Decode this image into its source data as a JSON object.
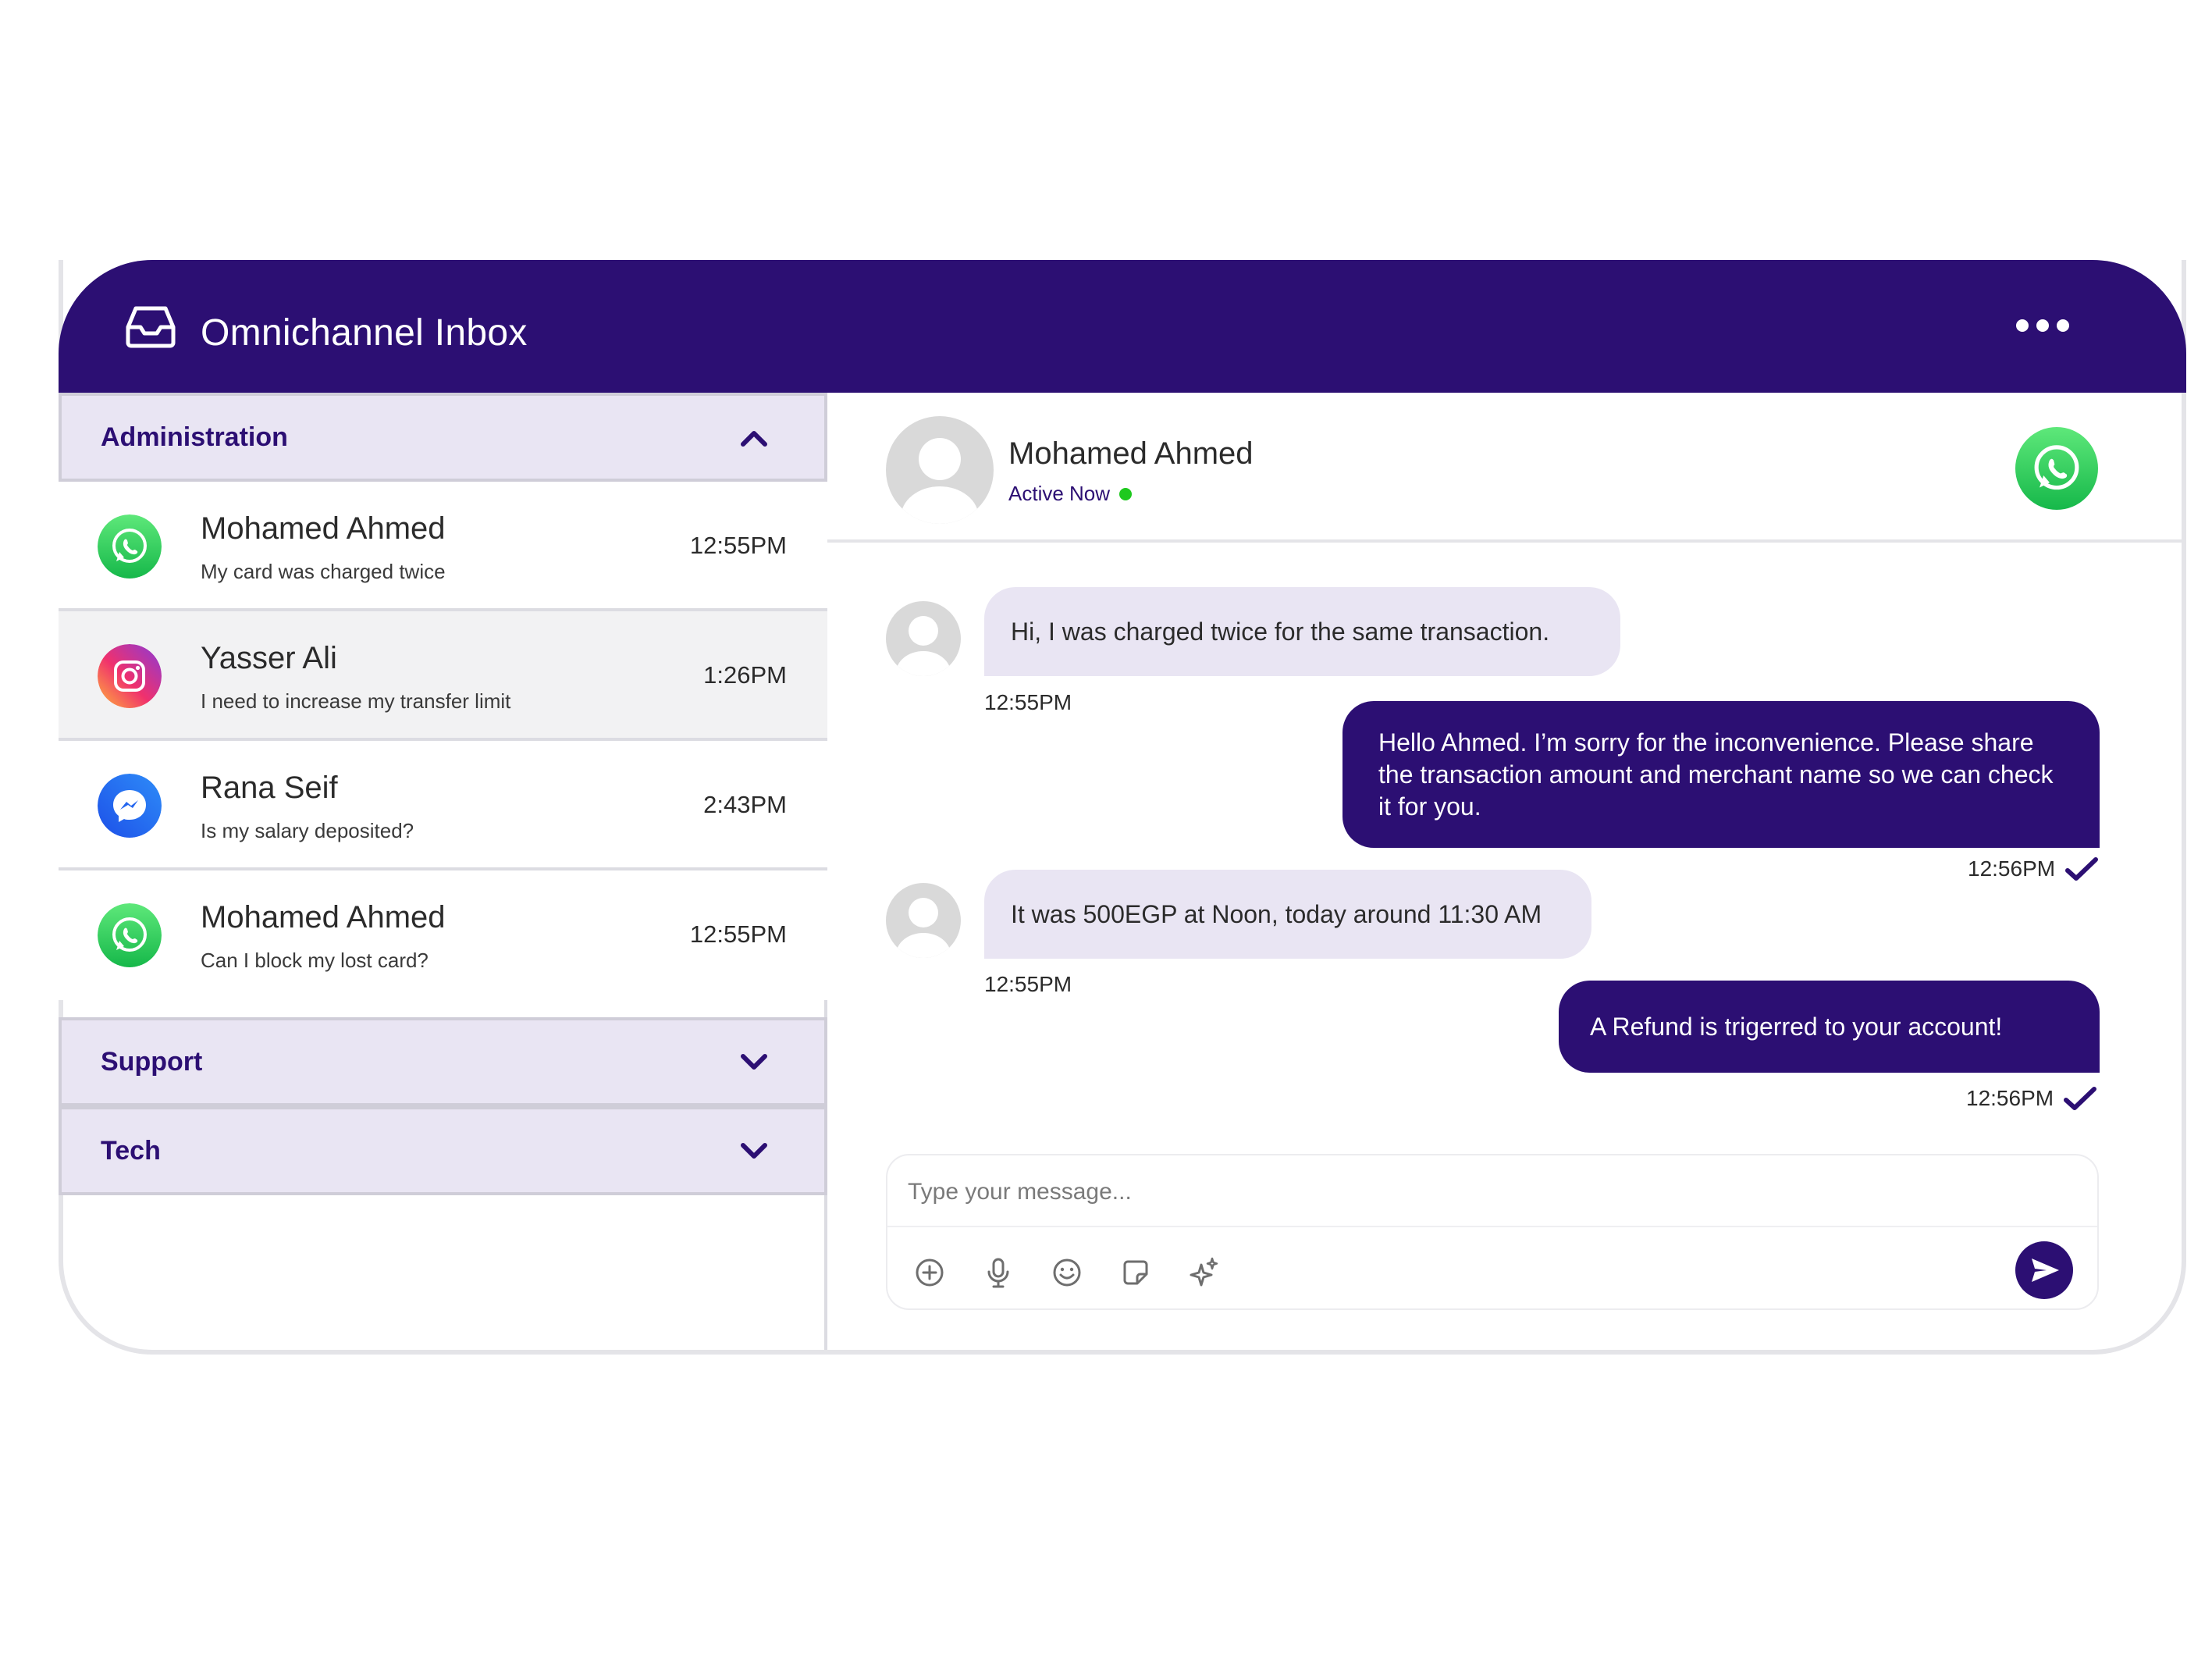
{
  "app": {
    "title": "Omnichannel Inbox"
  },
  "groups": [
    {
      "label": "Administration",
      "expanded": true
    },
    {
      "label": "Support",
      "expanded": false
    },
    {
      "label": "Tech",
      "expanded": false
    }
  ],
  "conversations": [
    {
      "channel": "whatsapp-icon",
      "name": "Mohamed Ahmed",
      "preview": "My card was charged twice",
      "time": "12:55PM"
    },
    {
      "channel": "instagram-icon",
      "name": "Yasser Ali",
      "preview": "I need to increase my transfer limit",
      "time": "1:26PM"
    },
    {
      "channel": "messenger-icon",
      "name": "Rana Seif",
      "preview": "Is my salary deposited?",
      "time": "2:43PM"
    },
    {
      "channel": "whatsapp-icon",
      "name": "Mohamed Ahmed",
      "preview": "Can I block my lost card?",
      "time": "12:55PM"
    }
  ],
  "chat": {
    "contact_name": "Mohamed Ahmed",
    "status": "Active Now",
    "channel": "whatsapp-icon",
    "messages": [
      {
        "direction": "in",
        "text": "Hi, I was charged twice for the same transaction.",
        "time": "12:55PM"
      },
      {
        "direction": "out",
        "text": "Hello Ahmed. I’m sorry for the inconvenience. Please share the transaction amount and merchant name so we can check it for you.",
        "time": "12:56PM"
      },
      {
        "direction": "in",
        "text": "It was 500EGP at Noon, today around 11:30 AM",
        "time": "12:55PM"
      },
      {
        "direction": "out",
        "text": "A Refund is trigerred to your account!",
        "time": "12:56PM"
      }
    ]
  },
  "composer": {
    "placeholder": "Type your message...",
    "tools": [
      "add-icon",
      "microphone-icon",
      "emoji-icon",
      "sticker-icon",
      "sparkle-ai-icon"
    ],
    "send": "send-icon"
  },
  "colors": {
    "brand": "#2c0f73",
    "accent_light": "#e9e5f3",
    "online": "#1ec91e",
    "whatsapp": "#25d366"
  }
}
